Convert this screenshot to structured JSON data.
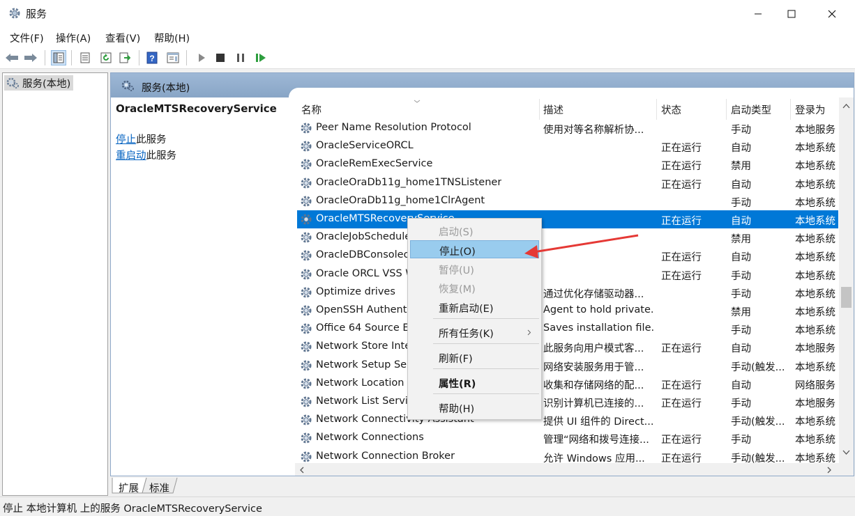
{
  "window": {
    "title": "服务",
    "app_icon": "gear-icon"
  },
  "menubar": [
    "文件(F)",
    "操作(A)",
    "查看(V)",
    "帮助(H)"
  ],
  "tree": {
    "root_label": "服务(本地)"
  },
  "panel": {
    "header_label": "服务(本地)",
    "selected_service": "OracleMTSRecoveryService",
    "stop_link": "停止",
    "stop_suffix": "此服务",
    "restart_link": "重启动",
    "restart_suffix": "此服务"
  },
  "columns": {
    "name": "名称",
    "desc": "描述",
    "status": "状态",
    "startup": "启动类型",
    "logon": "登录为"
  },
  "services": [
    {
      "name": "Peer Name Resolution Protocol",
      "desc": "使用对等名称解析协...",
      "status": "",
      "startup": "手动",
      "logon": "本地服务"
    },
    {
      "name": "OracleServiceORCL",
      "desc": "",
      "status": "正在运行",
      "startup": "自动",
      "logon": "本地系统"
    },
    {
      "name": "OracleRemExecService",
      "desc": "",
      "status": "正在运行",
      "startup": "禁用",
      "logon": "本地系统"
    },
    {
      "name": "OracleOraDb11g_home1TNSListener",
      "desc": "",
      "status": "正在运行",
      "startup": "自动",
      "logon": "本地系统"
    },
    {
      "name": "OracleOraDb11g_home1ClrAgent",
      "desc": "",
      "status": "",
      "startup": "手动",
      "logon": "本地系统"
    },
    {
      "name": "OracleMTSRecoveryService",
      "desc": "",
      "status": "正在运行",
      "startup": "自动",
      "logon": "本地系统"
    },
    {
      "name": "OracleJobScheduleORCL",
      "desc": "",
      "status": "",
      "startup": "禁用",
      "logon": "本地系统"
    },
    {
      "name": "OracleDBConsoleorcl",
      "desc": "",
      "status": "正在运行",
      "startup": "自动",
      "logon": "本地系统"
    },
    {
      "name": "Oracle ORCL VSS Writer Service",
      "desc": "",
      "status": "正在运行",
      "startup": "手动",
      "logon": "本地系统"
    },
    {
      "name": "Optimize drives",
      "desc": "通过优化存储驱动器...",
      "status": "",
      "startup": "手动",
      "logon": "本地系统"
    },
    {
      "name": "OpenSSH Authentication Agent",
      "desc": "Agent to hold private...",
      "status": "",
      "startup": "禁用",
      "logon": "本地系统"
    },
    {
      "name": "Office 64 Source Engine",
      "desc": "Saves installation file...",
      "status": "",
      "startup": "手动",
      "logon": "本地系统"
    },
    {
      "name": "Network Store Interface Service",
      "desc": "此服务向用户模式客...",
      "status": "正在运行",
      "startup": "自动",
      "logon": "本地服务"
    },
    {
      "name": "Network Setup Service",
      "desc": "网络安装服务用于管...",
      "status": "",
      "startup": "手动(触发...",
      "logon": "本地系统"
    },
    {
      "name": "Network Location Awareness",
      "desc": "收集和存储网络的配...",
      "status": "正在运行",
      "startup": "自动",
      "logon": "网络服务"
    },
    {
      "name": "Network List Service",
      "desc": "识别计算机已连接的...",
      "status": "正在运行",
      "startup": "手动",
      "logon": "本地服务"
    },
    {
      "name": "Network Connectivity Assistant",
      "desc": "提供 UI 组件的 Direct...",
      "status": "",
      "startup": "手动(触发...",
      "logon": "本地系统"
    },
    {
      "name": "Network Connections",
      "desc": "管理“网络和拨号连接...",
      "status": "正在运行",
      "startup": "手动",
      "logon": "本地系统"
    },
    {
      "name": "Network Connection Broker",
      "desc": "允许 Windows 应用...",
      "status": "正在运行",
      "startup": "手动(触发...",
      "logon": "本地系统"
    }
  ],
  "context_menu": {
    "start": "启动(S)",
    "stop": "停止(O)",
    "pause": "暂停(U)",
    "resume": "恢复(M)",
    "restart": "重新启动(E)",
    "all_tasks": "所有任务(K)",
    "refresh": "刷新(F)",
    "properties": "属性(R)",
    "help": "帮助(H)"
  },
  "bottom_tabs": [
    "扩展",
    "标准"
  ],
  "statusbar": "停止 本地计算机 上的服务 OracleMTSRecoveryService",
  "colors": {
    "selection": "#0078d7",
    "menu_highlight": "#99ccee",
    "arrow": "#e53935",
    "link": "#0060c0"
  }
}
